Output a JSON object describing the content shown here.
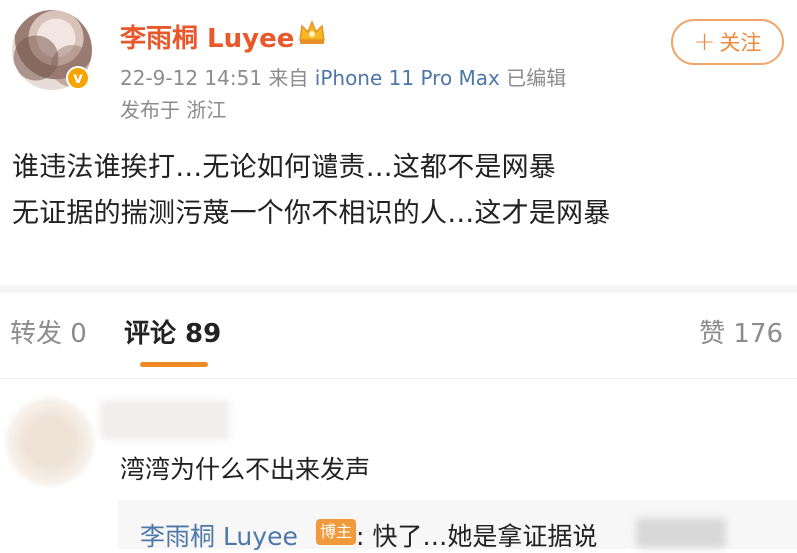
{
  "author": {
    "name": "李雨桐 Luyee",
    "verified_mark": "v",
    "time": "22-9-12 14:51",
    "source_prefix": "来自",
    "device": "iPhone 11 Pro Max",
    "edited": "已编辑",
    "location": "发布于 浙江"
  },
  "follow": {
    "plus": "+",
    "label": "关注"
  },
  "post": {
    "line1": "谁违法谁挨打…无论如何谴责…这都不是网暴",
    "line2": "无证据的揣测污蔑一个你不相识的人…这才是网暴"
  },
  "tabs": {
    "repost": "转发 0",
    "comment": "评论 89",
    "like": "赞 176"
  },
  "comment": {
    "text": "湾湾为什么不出来发声",
    "reply": {
      "name": "李雨桐 Luyee",
      "badge": "博主",
      "text": ": 快了…她是拿证据说"
    }
  },
  "colors": {
    "accent": "#f08a24",
    "username": "#e8582b",
    "link": "#4d77a8",
    "verified": "#f6a400"
  },
  "icons": [
    "crown-icon",
    "verified-badge-icon",
    "plus-icon"
  ]
}
